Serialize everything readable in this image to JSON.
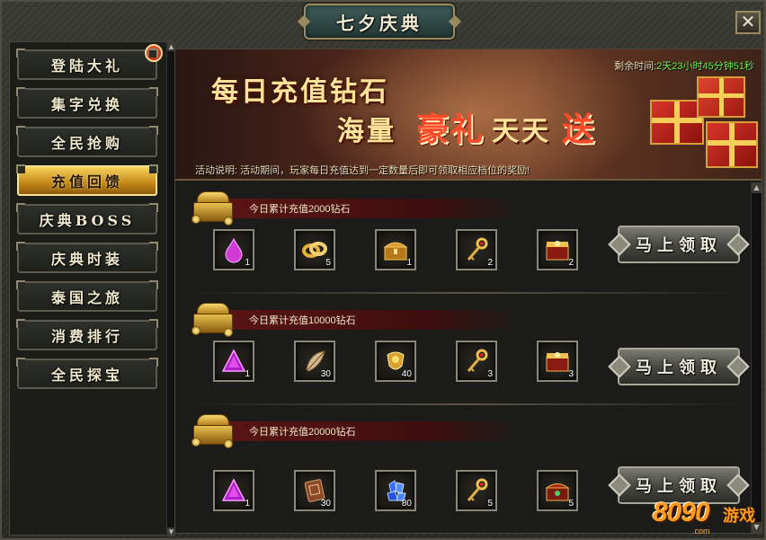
{
  "window": {
    "title": "七夕庆典",
    "close_label": "✕"
  },
  "sidebar": {
    "items": [
      {
        "label": "登陆大礼",
        "badge": "!"
      },
      {
        "label": "集字兑换"
      },
      {
        "label": "全民抢购"
      },
      {
        "label": "充值回馈",
        "active": true
      },
      {
        "label": "庆典BOSS"
      },
      {
        "label": "庆典时装"
      },
      {
        "label": "泰国之旅"
      },
      {
        "label": "消费排行"
      },
      {
        "label": "全民探宝"
      }
    ]
  },
  "banner": {
    "line1": "每日充值钻石",
    "line2_a": "海量",
    "line2_b": "豪礼",
    "line2_c": "天天",
    "line2_d": "送",
    "countdown_label": "剩余时间:",
    "countdown_value": "2天23小时45分钟51秒",
    "description": "活动说明:  活动期间，玩家每日充值达到一定数量后即可领取相应档位的奖励!"
  },
  "tiers": [
    {
      "title": "今日累计充值2000钻石",
      "claim_label": "马上领取",
      "items": [
        {
          "icon": "purple-drop-icon",
          "count": "1"
        },
        {
          "icon": "gold-rings-icon",
          "count": "5"
        },
        {
          "icon": "gold-chest-icon",
          "count": "1"
        },
        {
          "icon": "gold-key-icon",
          "count": "2"
        },
        {
          "icon": "treasure-box-icon",
          "count": "2"
        }
      ]
    },
    {
      "title": "今日累计充值10000钻石",
      "claim_label": "马上领取",
      "items": [
        {
          "icon": "purple-crystal-icon",
          "count": "1"
        },
        {
          "icon": "feather-icon",
          "count": "30"
        },
        {
          "icon": "gold-ornament-icon",
          "count": "40"
        },
        {
          "icon": "gold-key-icon",
          "count": "3"
        },
        {
          "icon": "treasure-box-icon",
          "count": "3"
        }
      ]
    },
    {
      "title": "今日累计充值20000钻石",
      "claim_label": "马上领取",
      "items": [
        {
          "icon": "purple-crystal-icon",
          "count": "1"
        },
        {
          "icon": "scroll-icon",
          "count": "30"
        },
        {
          "icon": "blue-gems-icon",
          "count": "80"
        },
        {
          "icon": "gold-key-icon",
          "count": "5"
        },
        {
          "icon": "jade-chest-icon",
          "count": "5"
        }
      ]
    }
  ],
  "watermark": {
    "number": "8090",
    "text": "游戏",
    "url": ".com"
  },
  "colors": {
    "accent_gold": "#c38718",
    "countdown_green": "#5cf04a",
    "banner_red": "#ff4a2a"
  }
}
